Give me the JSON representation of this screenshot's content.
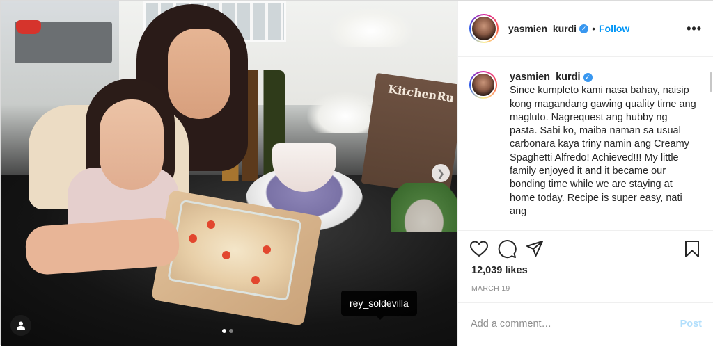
{
  "post": {
    "photo_tag": "rey_soldevilla",
    "carousel_total": 2,
    "carousel_index": 1
  },
  "header": {
    "username": "yasmien_kurdi",
    "separator": "•",
    "follow_label": "Follow",
    "more_label": "•••"
  },
  "caption": {
    "username": "yasmien_kurdi",
    "text": "Since kumpleto kami nasa bahay, naisip kong magandang gawing quality time ang magluto. Nagrequest ang hubby ng pasta. Sabi ko, maiba naman sa usual carbonara kaya triny namin ang Creamy Spaghetti Alfredo! Achieved!!! My little family enjoyed it and it became our bonding time while we are staying at home today. Recipe is super easy, nati ang"
  },
  "sign_text": "KitchenRu",
  "stats": {
    "likes": "12,039 likes",
    "date": "MARCH 19"
  },
  "comment": {
    "placeholder": "Add a comment…",
    "post_label": "Post"
  },
  "colors": {
    "link_blue": "#0095f6",
    "verified_blue": "#3897f0",
    "post_disabled": "#b2dffc"
  },
  "icons": [
    "heart-icon",
    "comment-icon",
    "share-icon",
    "bookmark-icon",
    "user-tag-icon",
    "verified-icon",
    "chevron-right-icon"
  ]
}
